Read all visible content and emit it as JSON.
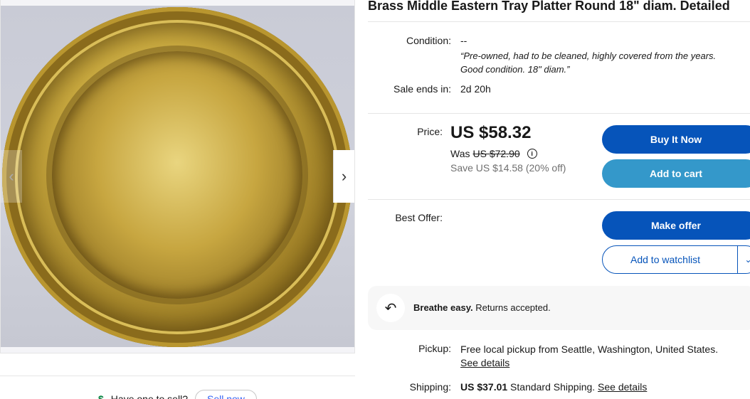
{
  "listing": {
    "title": "Brass Middle Eastern Tray Platter Round 18\" diam. Detailed"
  },
  "gallery": {
    "prev_icon": "chevron-left-icon",
    "next_icon": "chevron-right-icon",
    "prev_glyph": "‹",
    "next_glyph": "›"
  },
  "condition": {
    "label": "Condition:",
    "value": "--",
    "quote_line1": "“Pre-owned, had to be cleaned, highly covered from the years.",
    "quote_line2": "Good condition. 18\" diam.”"
  },
  "sale": {
    "label": "Sale ends in:",
    "value": "2d 20h"
  },
  "price": {
    "label": "Price:",
    "current": "US $58.32",
    "was_label": "Was",
    "was_value": "US $72.90",
    "info_glyph": "i",
    "save_text": "Save US $14.58 (20% off)"
  },
  "buttons": {
    "buy_now": "Buy It Now",
    "add_to_cart": "Add to cart",
    "make_offer": "Make offer",
    "watchlist": "Add to watchlist",
    "watchlist_chevron": "⌄"
  },
  "best_offer": {
    "label": "Best Offer:"
  },
  "returns": {
    "icon": "return-arrow-icon",
    "icon_glyph": "↶",
    "bold": "Breathe easy.",
    "text": " Returns accepted."
  },
  "pickup": {
    "label": "Pickup:",
    "value": "Free local pickup from Seattle, Washington, United States.",
    "link": "See details"
  },
  "shipping": {
    "label": "Shipping:",
    "amount": "US $37.01",
    "method": " Standard Shipping. ",
    "link": "See details"
  },
  "sell": {
    "icon_glyph": "$",
    "prompt": "Have one to sell?",
    "button": "Sell now"
  },
  "colors": {
    "primary": "#0654ba",
    "secondary": "#3498ca",
    "link": "#3665f3"
  }
}
